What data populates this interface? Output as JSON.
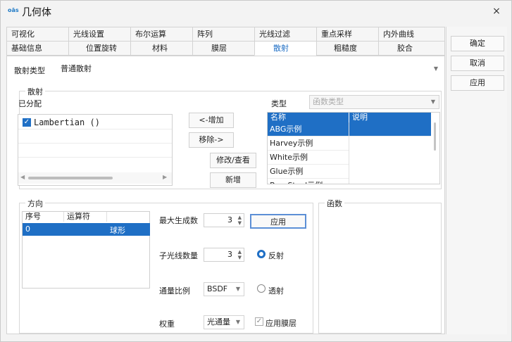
{
  "window": {
    "icon_text": "oās",
    "title": "几何体",
    "close": "×"
  },
  "tabs_row1": [
    "可视化",
    "光线设置",
    "布尔运算",
    "阵列",
    "光线过滤",
    "重点采样",
    "内外曲线"
  ],
  "tabs_row2": [
    "基础信息",
    "位置旋转",
    "材料",
    "膜层",
    "散射",
    "粗糙度",
    "胶合"
  ],
  "active_tab": "散射",
  "scatter_type": {
    "label": "散射类型",
    "value": "普通散射"
  },
  "scatter_group": {
    "title": "散射",
    "assigned_label": "已分配",
    "assigned_items": [
      "Lambertian ()"
    ],
    "add_button": "<-增加",
    "remove_button": "移除->",
    "modify_button": "修改/查看",
    "new_button": "新增",
    "type_label": "类型",
    "type_value": "函数类型",
    "table_headers": [
      "名称",
      "说明"
    ],
    "table_rows": [
      "ABG示例",
      "Harvey示例",
      "White示例",
      "Glue示例",
      "BareSteel示例"
    ]
  },
  "direction_group": {
    "title": "方向",
    "headers": [
      "序号",
      "运算符"
    ],
    "row": {
      "index": "0",
      "op": "",
      "shape": "球形"
    }
  },
  "controls": {
    "max_gen_label": "最大生成数",
    "max_gen_value": "3",
    "apply_button": "应用",
    "sub_rays_label": "子光线数量",
    "sub_rays_value": "3",
    "reflect_label": "反射",
    "flux_label": "通量比例",
    "flux_value": "BSDF",
    "transmit_label": "透射",
    "weight_label": "权重",
    "weight_value": "光通量",
    "apply_coating_label": "应用膜层"
  },
  "function_group": {
    "title": "函数"
  },
  "side_buttons": {
    "ok": "确定",
    "cancel": "取消",
    "apply": "应用"
  }
}
